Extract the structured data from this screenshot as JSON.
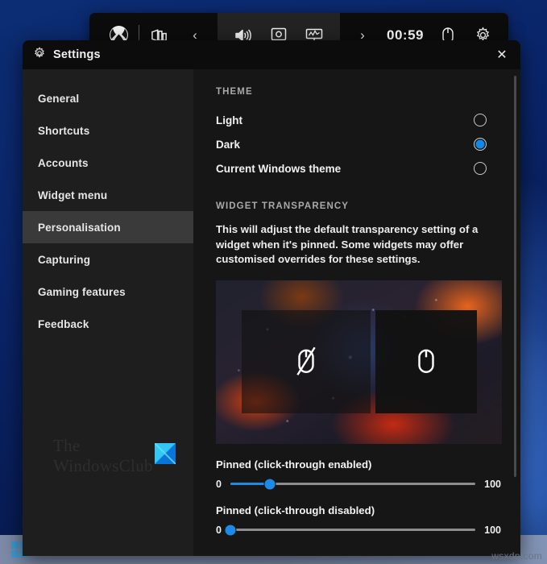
{
  "gamebar": {
    "xbox_icon": "xbox-logo-icon",
    "widgets_icon": "widgets-icon",
    "back_chevron": "‹",
    "audio_icon": "audio-volume-icon",
    "capture_icon": "capture-icon",
    "performance_icon": "performance-monitor-icon",
    "forward_chevron": "›",
    "clock": "00:59",
    "mouse_icon": "mouse-icon",
    "settings_icon": "gear-icon"
  },
  "window": {
    "title": "Settings",
    "title_icon": "gear-icon",
    "close_label": "✕"
  },
  "sidebar": {
    "items": [
      {
        "label": "General",
        "selected": false
      },
      {
        "label": "Shortcuts",
        "selected": false
      },
      {
        "label": "Accounts",
        "selected": false
      },
      {
        "label": "Widget menu",
        "selected": false
      },
      {
        "label": "Personalisation",
        "selected": true
      },
      {
        "label": "Capturing",
        "selected": false
      },
      {
        "label": "Gaming features",
        "selected": false
      },
      {
        "label": "Feedback",
        "selected": false
      }
    ],
    "watermark": {
      "line1": "The",
      "line2": "WindowsClub"
    }
  },
  "content": {
    "theme": {
      "heading": "THEME",
      "options": [
        {
          "label": "Light",
          "selected": false
        },
        {
          "label": "Dark",
          "selected": true
        },
        {
          "label": "Current Windows theme",
          "selected": false
        }
      ]
    },
    "transparency": {
      "heading": "WIDGET TRANSPARENCY",
      "description": "This will adjust the default transparency setting of a widget when it's pinned. Some widgets may offer customised overrides for these settings.",
      "preview": {
        "left_panel_icon": "mouse-click-through-disabled-icon",
        "right_panel_icon": "mouse-icon"
      },
      "sliders": [
        {
          "label": "Pinned (click-through enabled)",
          "min": "0",
          "max": "100",
          "value": 16
        },
        {
          "label": "Pinned (click-through disabled)",
          "min": "0",
          "max": "100",
          "value": 0
        }
      ]
    }
  },
  "page": {
    "watermark": "wsxdn.com"
  },
  "colors": {
    "accent_blue": "#1e8ae8",
    "radio_blue": "#1488e8",
    "sidebar_bg": "#1e1e1e",
    "content_bg": "#161616",
    "selected_item_bg": "#3a3a3a"
  }
}
